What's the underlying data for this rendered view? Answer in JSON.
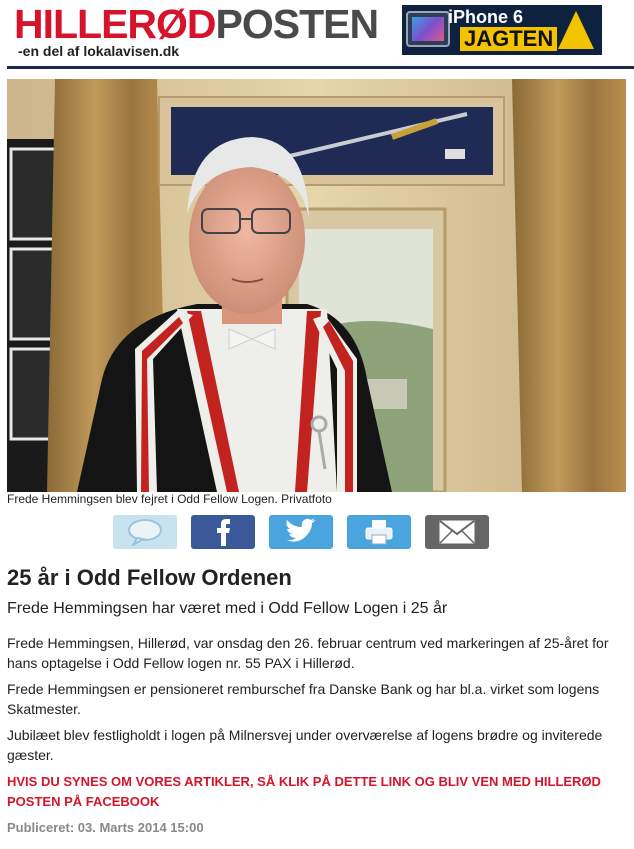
{
  "header": {
    "logo_red": "HILLERØD",
    "logo_gray": "POSTEN",
    "logo_sub": "-en del af lokalavisen.dk"
  },
  "ad": {
    "line1": "iPhone 6",
    "line2": "JAGTEN"
  },
  "article": {
    "photo_caption": "Frede Hemmingsen blev fejret i Odd Fellow Logen. Privatfoto",
    "headline": "25 år i Odd Fellow Ordenen",
    "subheadline": "Frede Hemmingsen har været med i Odd Fellow Logen i 25 år",
    "paragraphs": [
      "Frede Hemmingsen, Hillerød, var onsdag den 26. februar centrum ved markeringen af 25-året for hans optagelse i Odd Fellow logen nr. 55 PAX i Hillerød.",
      "Frede Hemmingsen er pensioneret remburschef fra Danske Bank og har bl.a. virket som logens Skatmester.",
      "Jubilæet blev festligholdt i logen på Milnersvej under overværelse af logens brødre og inviterede gæster."
    ],
    "facebook_cta": "HVIS DU SYNES OM VORES ARTIKLER, SÅ KLIK PÅ DETTE LINK OG BLIV VEN MED HILLERØD POSTEN PÅ FACEBOOK",
    "published": "Publiceret: 03. Marts 2014 15:00"
  },
  "share": [
    {
      "icon": "comment-icon",
      "color": "#c7e3ef"
    },
    {
      "icon": "facebook-icon",
      "color": "#3b5998"
    },
    {
      "icon": "twitter-icon",
      "color": "#4aa4de"
    },
    {
      "icon": "print-icon",
      "color": "#4aa4de"
    },
    {
      "icon": "email-icon",
      "color": "#666666"
    }
  ],
  "colors": {
    "brand_red": "#d5142b",
    "rule_navy": "#1d2a4a"
  }
}
